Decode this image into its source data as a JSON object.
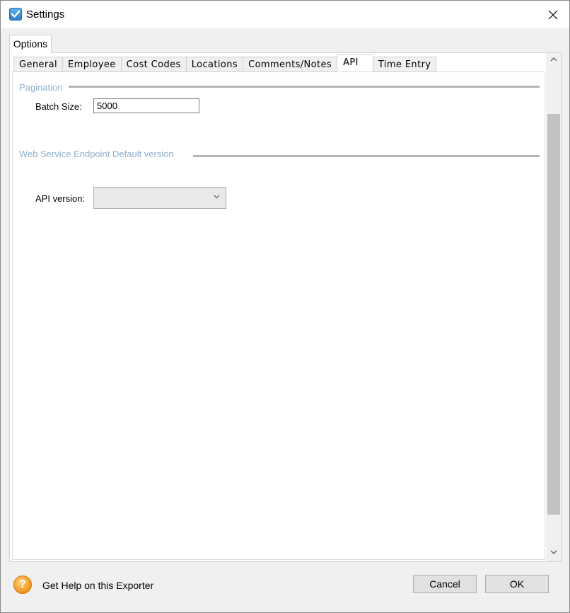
{
  "window": {
    "title": "Settings"
  },
  "outer_tab": {
    "label": "Options"
  },
  "tabs": [
    {
      "label": "General",
      "active": false
    },
    {
      "label": "Employee",
      "active": false
    },
    {
      "label": "Cost Codes",
      "active": false
    },
    {
      "label": "Locations",
      "active": false
    },
    {
      "label": "Comments/Notes",
      "active": false
    },
    {
      "label": "API",
      "active": true
    },
    {
      "label": "Time Entry",
      "active": false
    }
  ],
  "pagination": {
    "group_label": "Pagination",
    "batch_size_label": "Batch Size:",
    "batch_size_value": "5000"
  },
  "endpoint": {
    "group_label": "Web Service Endpoint Default version",
    "api_version_label": "API version:",
    "api_version_value": ""
  },
  "footer": {
    "help_text": "Get Help on this Exporter",
    "help_icon_glyph": "?",
    "cancel_label": "Cancel",
    "ok_label": "OK"
  },
  "colors": {
    "group_label": "#8fb0cf",
    "help_icon": "#f0951c"
  },
  "icons": {
    "app": "checkbox-app-icon",
    "close": "close-icon",
    "help": "help-icon",
    "dropdown": "chevron-down-icon"
  }
}
